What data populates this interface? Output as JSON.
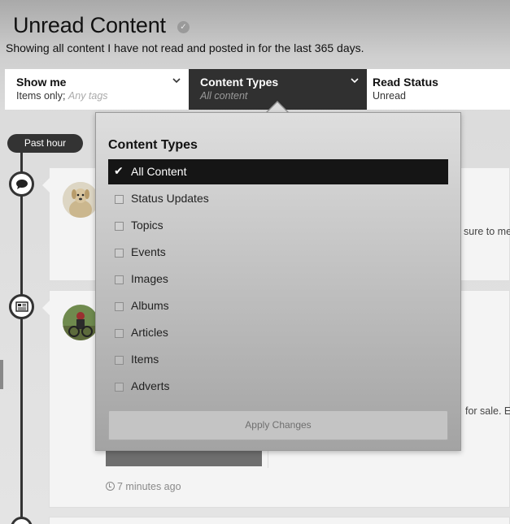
{
  "page": {
    "title": "Unread Content",
    "subtitle": "Showing all content I have not read and posted in for the last 365 days."
  },
  "filters": {
    "show_me": {
      "title": "Show me",
      "value_prefix": "Items only;",
      "value_tag": "Any tags"
    },
    "content_types": {
      "title": "Content Types",
      "value": "All content"
    },
    "read_status": {
      "title": "Read Status",
      "value": "Unread"
    }
  },
  "timeline": {
    "time_label": "Past hour",
    "items": [
      {
        "icon": "speech-bubble-icon",
        "snippet": "sure to me"
      },
      {
        "icon": "newspaper-icon",
        "snippet": "for sale. E",
        "timestamp": "7 minutes ago"
      }
    ]
  },
  "dropdown": {
    "title": "Content Types",
    "options": [
      {
        "label": "All Content",
        "selected": true
      },
      {
        "label": "Status Updates",
        "selected": false
      },
      {
        "label": "Topics",
        "selected": false
      },
      {
        "label": "Events",
        "selected": false
      },
      {
        "label": "Images",
        "selected": false
      },
      {
        "label": "Albums",
        "selected": false
      },
      {
        "label": "Articles",
        "selected": false
      },
      {
        "label": "Items",
        "selected": false
      },
      {
        "label": "Adverts",
        "selected": false
      }
    ],
    "apply_label": "Apply Changes"
  },
  "colors": {
    "dark": "#303030",
    "selected_bg": "#151515",
    "timeline": "#333333"
  }
}
